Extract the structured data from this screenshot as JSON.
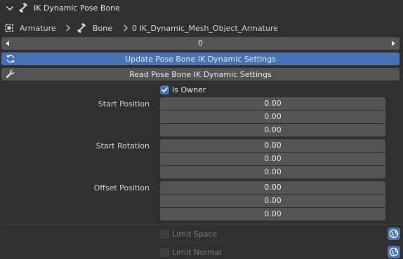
{
  "header": {
    "title": "IK Dynamic Pose Bone"
  },
  "breadcrumb": {
    "armature": "Armature",
    "bone": "Bone",
    "object": "0 IK_Dynamic_Mesh_Object_Armature"
  },
  "index_field": {
    "value": "0"
  },
  "buttons": {
    "update": "Update Pose Bone IK Dynamic Settings",
    "read": "Read Pose Bone IK Dynamic Settings"
  },
  "is_owner": {
    "label": "Is Owner",
    "checked": true
  },
  "start_position": {
    "label": "Start Position",
    "values": [
      "0.00",
      "0.00",
      "0.00"
    ]
  },
  "start_rotation": {
    "label": "Start Rotation",
    "values": [
      "0.00",
      "0.00",
      "0.00"
    ]
  },
  "offset_position": {
    "label": "Offset Position",
    "values": [
      "0.00",
      "0.00",
      "0.00"
    ]
  },
  "limit_space": {
    "label": "Limit Space",
    "checked": false
  },
  "limit_normal": {
    "label": "Limit Normal",
    "checked": false
  },
  "colors": {
    "accent": "#4772b3",
    "field": "#545454",
    "background": "#303030"
  }
}
